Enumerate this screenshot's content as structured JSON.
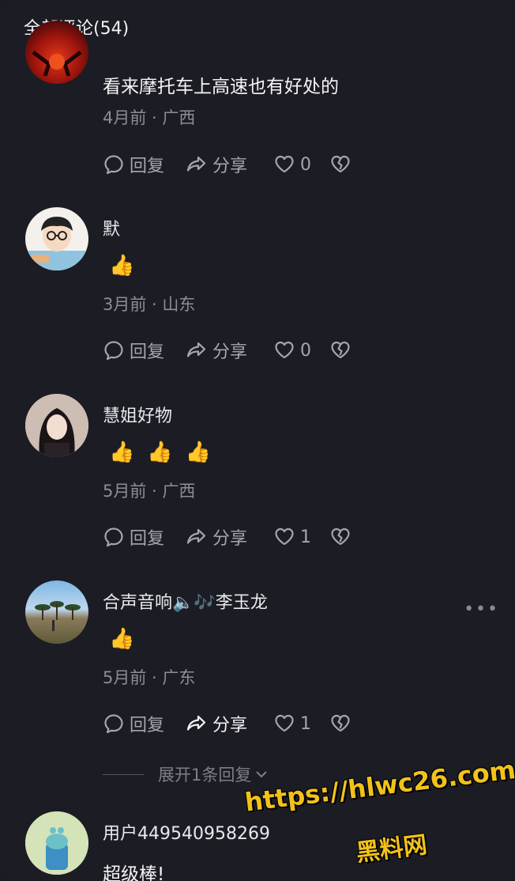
{
  "header": {
    "title": "全部评论(54)"
  },
  "icons": {
    "reply": "comment-bubble-icon",
    "share": "share-arrow-icon",
    "like": "heart-icon",
    "dislike": "broken-heart-icon",
    "more": "more-dots-icon",
    "expand": "chevron-down-icon"
  },
  "comments": [
    {
      "text": "看来摩托车上高速也有好处的",
      "meta": "4月前 · 广西",
      "reply_label": "回复",
      "share_label": "分享",
      "likes": "0"
    },
    {
      "username": "默",
      "emoji": "👍",
      "meta": "3月前 · 山东",
      "reply_label": "回复",
      "share_label": "分享",
      "likes": "0"
    },
    {
      "username": "慧姐好物",
      "emoji": "👍👍👍",
      "meta": "5月前 · 广西",
      "reply_label": "回复",
      "share_label": "分享",
      "likes": "1"
    },
    {
      "username": "合声音响🔈🎶李玉龙",
      "emoji": "👍",
      "meta": "5月前 · 广东",
      "reply_label": "回复",
      "share_label": "分享",
      "likes": "1",
      "more": "•••"
    },
    {
      "username": "用户449540958269",
      "text": "超级棒!"
    }
  ],
  "expand_replies": {
    "label": "展开1条回复"
  },
  "watermark": {
    "line1": "https://hlwc26.com",
    "line2": "黑料网"
  }
}
